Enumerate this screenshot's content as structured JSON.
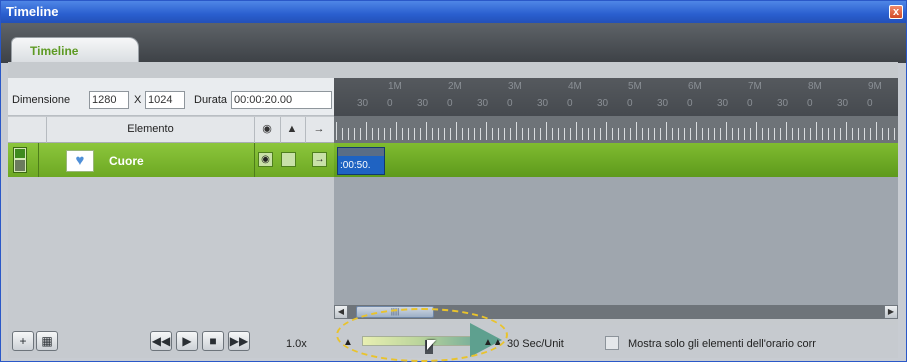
{
  "window": {
    "title": "Timeline",
    "close_glyph": "x"
  },
  "tab": {
    "label": "Timeline"
  },
  "dimension": {
    "label": "Dimensione",
    "width_value": "1280",
    "x_label": "X",
    "height_value": "1024",
    "duration_label": "Durata",
    "duration_value": "00:00:20.00"
  },
  "columns": {
    "element_label": "Elemento",
    "icons": [
      "eye-icon",
      "lock-icon",
      "arrow-right-icon"
    ]
  },
  "ruler": {
    "major_labels": [
      "1M",
      "2M",
      "3M",
      "4M",
      "5M",
      "6M",
      "7M",
      "8M",
      "9M"
    ],
    "minor_labels": [
      "30",
      "0",
      "30",
      "0",
      "30",
      "0",
      "30",
      "0",
      "30",
      "0",
      "30",
      "0",
      "30",
      "0",
      "30",
      "0",
      "30",
      "0"
    ]
  },
  "track": {
    "name": "Cuore",
    "icon": "heart-icon",
    "clip_label": ":00:50."
  },
  "toolbar": {
    "speed": "1.0x",
    "sec_unit": "30 Sec/Unit",
    "show_only_label": "Mostra solo gli elementi dell'orario corr",
    "colors": {
      "accent_green": "#7ab52d",
      "clip_blue": "#1f63c2",
      "highlight": "#e9c32c"
    }
  }
}
